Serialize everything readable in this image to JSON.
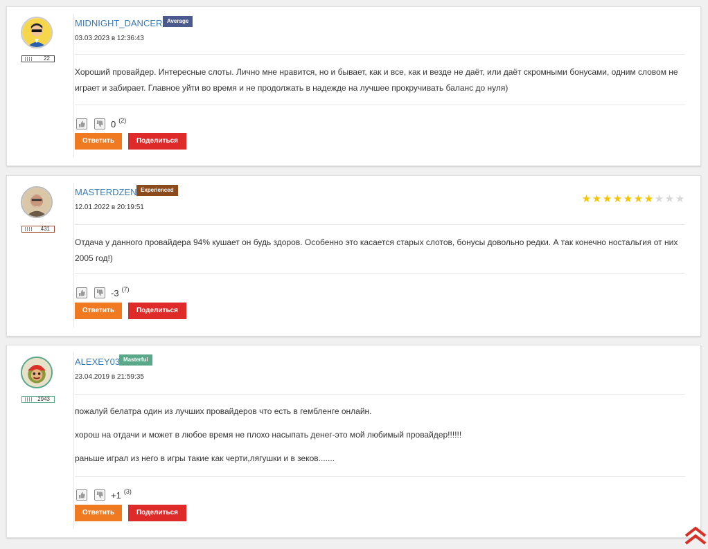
{
  "comments": [
    {
      "username": "MIDNIGHT_DANCER",
      "rank": "Average",
      "rank_color": "#4a5a8c",
      "count": "22",
      "badge_color": "#444444",
      "date": "03.03.2023 в 12:36:43",
      "paragraphs": [
        "Хороший провайдер. Интересные слоты. Лично мне нравится, но и бывает, как и все, как и везде не даёт, или даёт скромными бонусами, одним словом не играет и забирает. Главное уйти во время и не продолжать в надежде на лучшее прокручивать баланс до нуля)"
      ],
      "score": "0",
      "votes": "(2)",
      "reply_label": "Ответить",
      "share_label": "Поделиться"
    },
    {
      "username": "MASTERDZEN",
      "rank": "Experienced",
      "rank_color": "#8a4a1c",
      "count": "431",
      "badge_color": "#9a4a2a",
      "date": "12.01.2022 в 20:19:51",
      "rating": 7,
      "rating_max": 10,
      "paragraphs": [
        "Отдача у данного провайдера 94% кушает он будь здоров. Особенно это касается старых слотов, бонусы довольно редки. А так конечно ностальгия от них 2005 год!)"
      ],
      "score": "-3",
      "votes": "(7)",
      "reply_label": "Ответить",
      "share_label": "Поделиться"
    },
    {
      "username": "ALEXEY03",
      "rank": "Masterful",
      "rank_color": "#5aa88a",
      "count": "2943",
      "badge_color": "#5aa88a",
      "date": "23.04.2019 в 21:59:35",
      "paragraphs": [
        "пожалуй белатра один из лучших провайдеров что есть в гембленге онлайн.",
        "хорош на отдачи и может в любое время не плохо насыпать денег-это мой любимый провайдер!!!!!!",
        "раньше играл из него в игры такие как черти,лягушки и в зеков......."
      ],
      "score": "+1",
      "votes": "(3)",
      "reply_label": "Ответить",
      "share_label": "Поделиться"
    }
  ],
  "colors": {
    "username": "#3a7ab5",
    "reply": "#f07a22",
    "share": "#df2a2a",
    "star_on": "#f5c400",
    "star_off": "#d8d8d8",
    "scroll_top": "#d93025"
  },
  "icons": {
    "like": "thumbs-up-icon",
    "dislike": "thumbs-down-icon",
    "scroll_top": "double-chevron-up-icon",
    "rating_star": "star-icon"
  }
}
